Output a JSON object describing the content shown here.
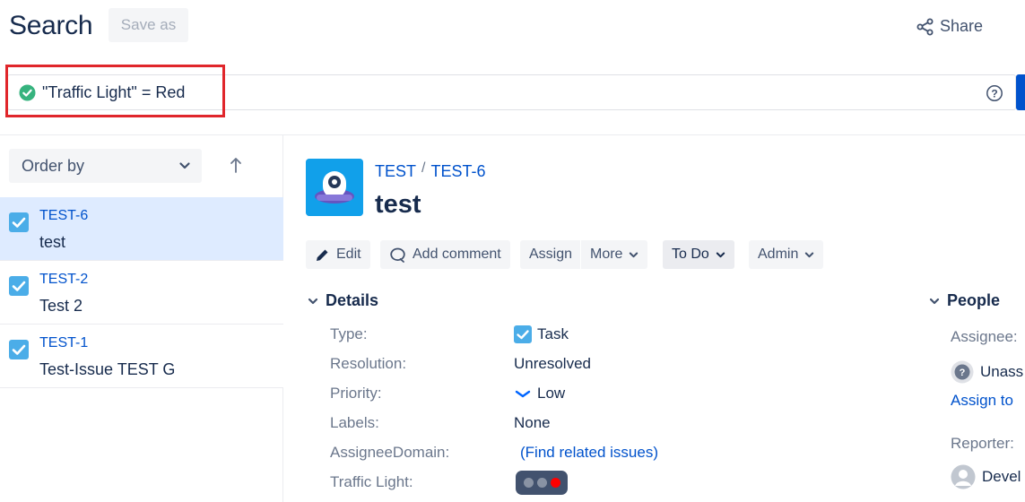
{
  "header": {
    "title": "Search",
    "save_as_label": "Save as",
    "share_label": "Share"
  },
  "search": {
    "query": "\"Traffic Light\" = Red"
  },
  "list": {
    "order_by_label": "Order by",
    "items": [
      {
        "key": "TEST-6",
        "summary": "test",
        "selected": true
      },
      {
        "key": "TEST-2",
        "summary": "Test 2",
        "selected": false
      },
      {
        "key": "TEST-1",
        "summary": "Test-Issue TEST G",
        "selected": false
      }
    ]
  },
  "issue": {
    "project": "TEST",
    "key": "TEST-6",
    "title": "test",
    "actions": {
      "edit": "Edit",
      "add_comment": "Add comment",
      "assign": "Assign",
      "more": "More",
      "status": "To Do",
      "admin": "Admin"
    }
  },
  "details": {
    "heading": "Details",
    "fields": [
      {
        "label": "Type:",
        "value": "Task",
        "icon": "task-icon"
      },
      {
        "label": "Resolution:",
        "value": "Unresolved"
      },
      {
        "label": "Priority:",
        "value": "Low",
        "icon": "priority-low-icon"
      },
      {
        "label": "Labels:",
        "value": "None"
      },
      {
        "label": "AssigneeDomain:",
        "value": "(Find related issues)"
      },
      {
        "label": "Traffic Light:",
        "value_colors": [
          "#8993a4",
          "#8993a4",
          "#ff0000"
        ]
      }
    ]
  },
  "people": {
    "heading": "People",
    "assignee_label": "Assignee:",
    "assignee_value": "Unass",
    "assign_to_me": "Assign to",
    "reporter_label": "Reporter:",
    "reporter_value": "Devel"
  },
  "colors": {
    "accent": "#0052cc",
    "highlight_box": "#e0262b",
    "success": "#36b37e",
    "selected_row": "#deebff"
  }
}
